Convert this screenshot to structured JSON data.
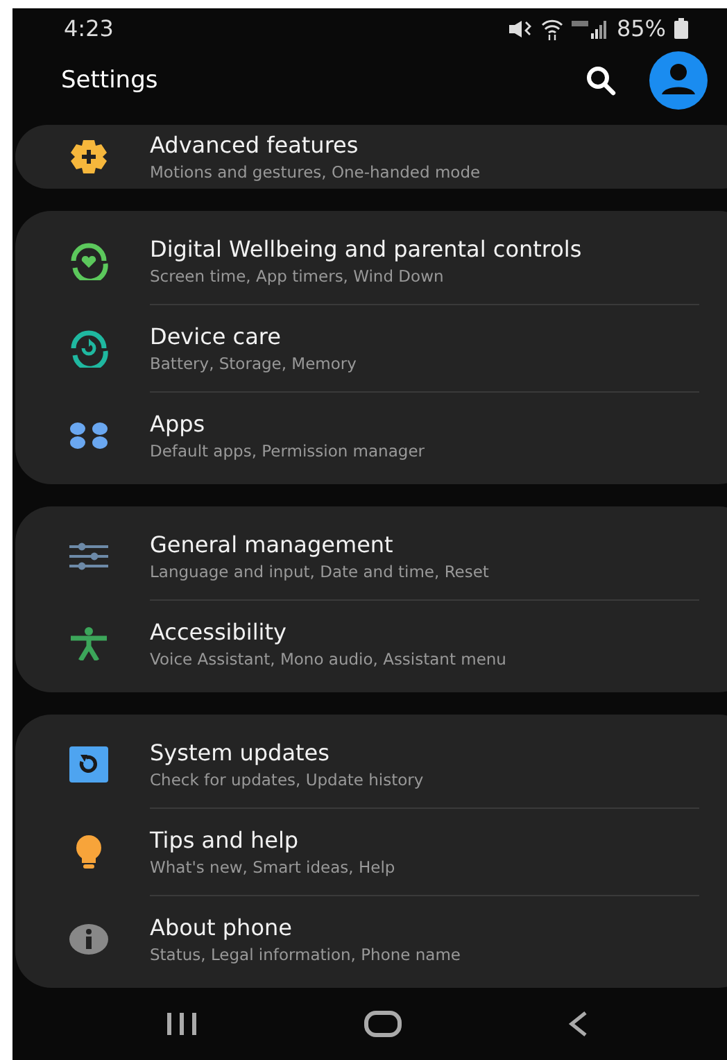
{
  "status_bar": {
    "time": "4:23",
    "battery": "85%"
  },
  "header": {
    "title": "Settings"
  },
  "groups": [
    {
      "items": [
        {
          "title": "Advanced features",
          "subtitle": "Motions and gestures, One-handed mode"
        }
      ]
    },
    {
      "items": [
        {
          "title": "Digital Wellbeing and parental controls",
          "subtitle": "Screen time, App timers, Wind Down"
        },
        {
          "title": "Device care",
          "subtitle": "Battery, Storage, Memory"
        },
        {
          "title": "Apps",
          "subtitle": "Default apps, Permission manager"
        }
      ]
    },
    {
      "items": [
        {
          "title": "General management",
          "subtitle": "Language and input, Date and time, Reset"
        },
        {
          "title": "Accessibility",
          "subtitle": "Voice Assistant, Mono audio, Assistant menu"
        }
      ]
    },
    {
      "items": [
        {
          "title": "System updates",
          "subtitle": "Check for updates, Update history"
        },
        {
          "title": "Tips and help",
          "subtitle": "What's new, Smart ideas, Help"
        },
        {
          "title": "About phone",
          "subtitle": "Status, Legal information, Phone name"
        }
      ]
    }
  ]
}
